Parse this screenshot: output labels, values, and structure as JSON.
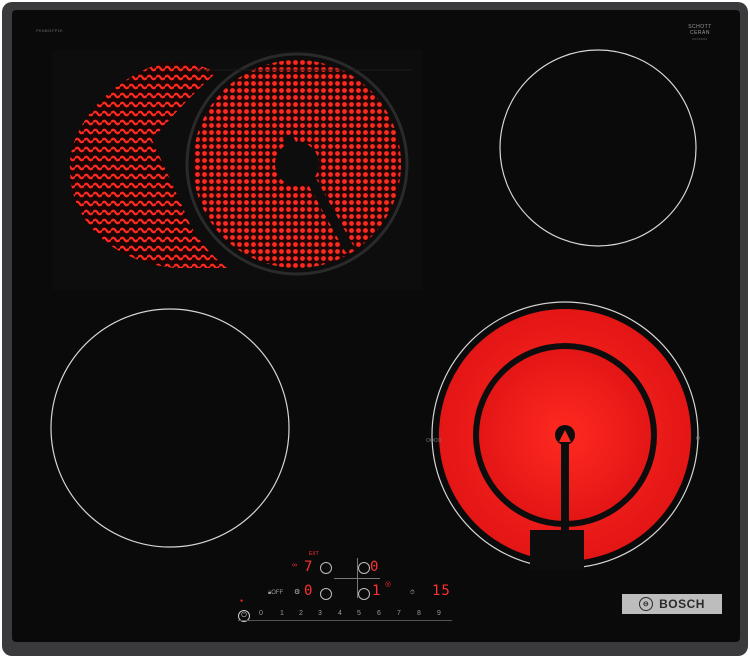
{
  "brand": {
    "model_code": "PKN651FP1E",
    "schott": {
      "line1": "SCHOTT",
      "line2": "CERAN",
      "sub": "0000000"
    },
    "logo_text": "BOSCH"
  },
  "zones": [
    {
      "name": "rear-left",
      "type": "dual-oval",
      "state": "on"
    },
    {
      "name": "rear-right",
      "type": "single",
      "state": "off"
    },
    {
      "name": "front-left",
      "type": "single",
      "state": "off"
    },
    {
      "name": "front-right",
      "type": "dual-circle",
      "state": "on"
    }
  ],
  "controls": {
    "zone_displays": [
      {
        "value": "7",
        "sup": "EXT"
      },
      {
        "value": "0"
      },
      {
        "value": "0"
      },
      {
        "value": "1"
      }
    ],
    "timer_display": "15",
    "labels": {
      "lock": "OFF",
      "left": "0",
      "right": "0"
    },
    "slider_values": [
      "0",
      "1",
      "2",
      "3",
      "4",
      "5",
      "6",
      "7",
      "8",
      "9"
    ]
  },
  "colors": {
    "glass": "#0a0a0a",
    "frame": "#3a3a3c",
    "heat_red": "#ff2020",
    "ring_line": "#cfcfcf",
    "logo_bg": "#bdbdbd"
  }
}
